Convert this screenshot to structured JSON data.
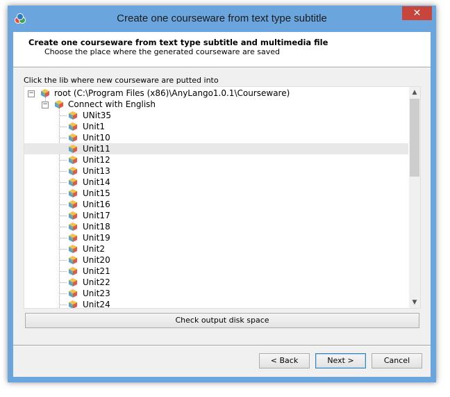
{
  "window": {
    "title": "Create one courseware from text type subtitle",
    "close_glyph": "✕"
  },
  "header": {
    "title": "Create one courseware from text type subtitle and multimedia file",
    "subtitle": "Choose the place where the generated courseware are saved"
  },
  "tree_label": "Click the lib where new courseware are putted into",
  "tree": {
    "root": {
      "label": "root (C:\\Program Files (x86)\\AnyLango1.0.1\\Courseware)",
      "expander": "−"
    },
    "group": {
      "label": "Connect with English",
      "expander": "−"
    },
    "items": [
      {
        "label": "UNit35"
      },
      {
        "label": "Unit1"
      },
      {
        "label": "Unit10"
      },
      {
        "label": "Unit11",
        "selected": true
      },
      {
        "label": "Unit12"
      },
      {
        "label": "Unit13"
      },
      {
        "label": "Unit14"
      },
      {
        "label": "Unit15"
      },
      {
        "label": "Unit16"
      },
      {
        "label": "Unit17"
      },
      {
        "label": "Unit18"
      },
      {
        "label": "Unit19"
      },
      {
        "label": "Unit2"
      },
      {
        "label": "Unit20"
      },
      {
        "label": "Unit21"
      },
      {
        "label": "Unit22"
      },
      {
        "label": "Unit23"
      },
      {
        "label": "Unit24"
      }
    ],
    "icon": "cube-icon"
  },
  "scroll": {
    "up_glyph": "▲",
    "down_glyph": "▼"
  },
  "buttons": {
    "check": "Check output disk space",
    "back": "< Back",
    "next": "Next >",
    "cancel": "Cancel"
  },
  "colors": {
    "window_border": "#6aa6dd",
    "close": "#c7453b",
    "selection": "#e8e8e8"
  }
}
